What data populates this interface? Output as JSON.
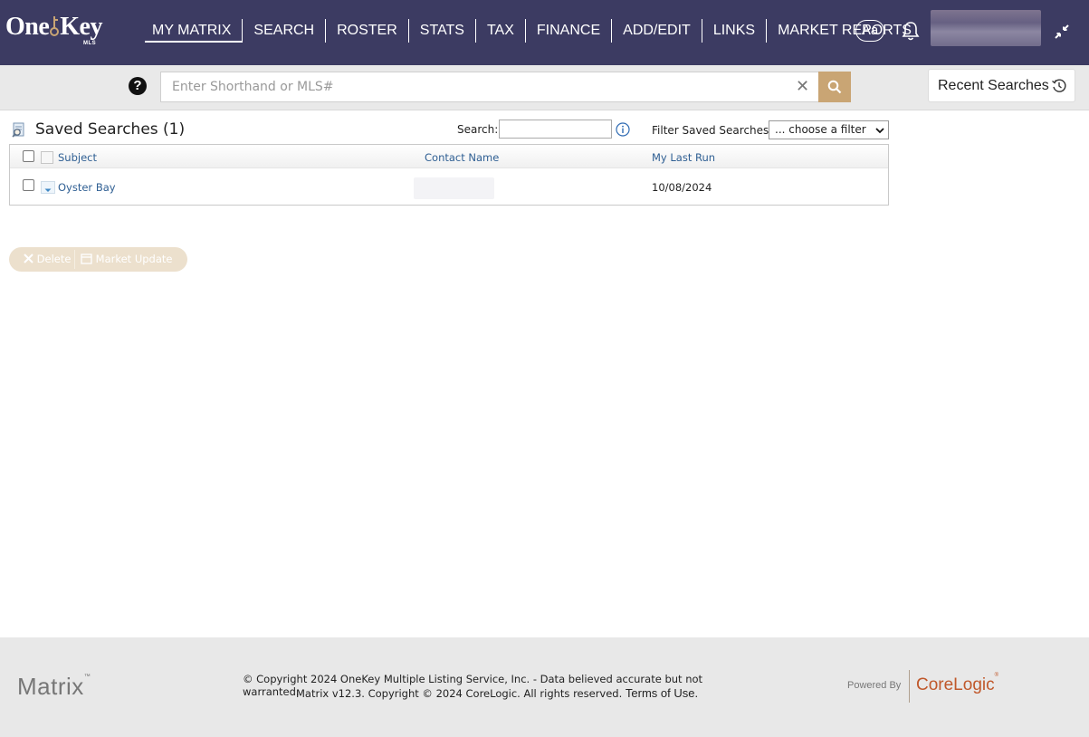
{
  "header": {
    "logo_text_one": "One",
    "logo_text_key": "Key",
    "logo_sub": "MLS",
    "nav": [
      "MY MATRIX",
      "SEARCH",
      "ROSTER",
      "STATS",
      "TAX",
      "FINANCE",
      "ADD/EDIT",
      "LINKS",
      "MARKET REPORTS"
    ],
    "active_nav": "MY MATRIX",
    "font_size_button": "Aa",
    "icons": {
      "notifications": "bell-icon",
      "collapse": "collapse-arrows-icon"
    }
  },
  "quicksearch": {
    "help_glyph": "?",
    "placeholder": "Enter Shorthand or MLS#",
    "value": "",
    "clear_glyph": "✕",
    "recent_label": "Recent Searches"
  },
  "saved_searches": {
    "title": "Saved Searches (1)",
    "search_label": "Search:",
    "filter_label": "Filter Saved Searches:",
    "filter_selected": "... choose a filter",
    "columns": [
      "Subject",
      "Contact Name",
      "My Last Run"
    ],
    "rows": [
      {
        "subject": "Oyster Bay",
        "contact": "",
        "last_run": "10/08/2024"
      }
    ],
    "actions": {
      "delete": "Delete",
      "market_update": "Market Update"
    }
  },
  "footer": {
    "matrix_logo": "Matrix",
    "tm": "™",
    "copyright_line1": "© Copyright 2024 OneKey Multiple Listing Service, Inc. - Data believed accurate but not warranted.",
    "copyright_line2": "Matrix v12.3. Copyright © 2024 CoreLogic. All rights reserved.",
    "terms_link": "Terms of Use.",
    "powered_by": "Powered By",
    "corelogic": "CoreLogic",
    "corelogic_mark": "®"
  },
  "colors": {
    "nav_bg": "#3c3b62",
    "search_button": "#c9a574",
    "link": "#2f5f93",
    "action_bar_disabled": "#ece0cd",
    "corelogic_orange": "#c0582b"
  }
}
